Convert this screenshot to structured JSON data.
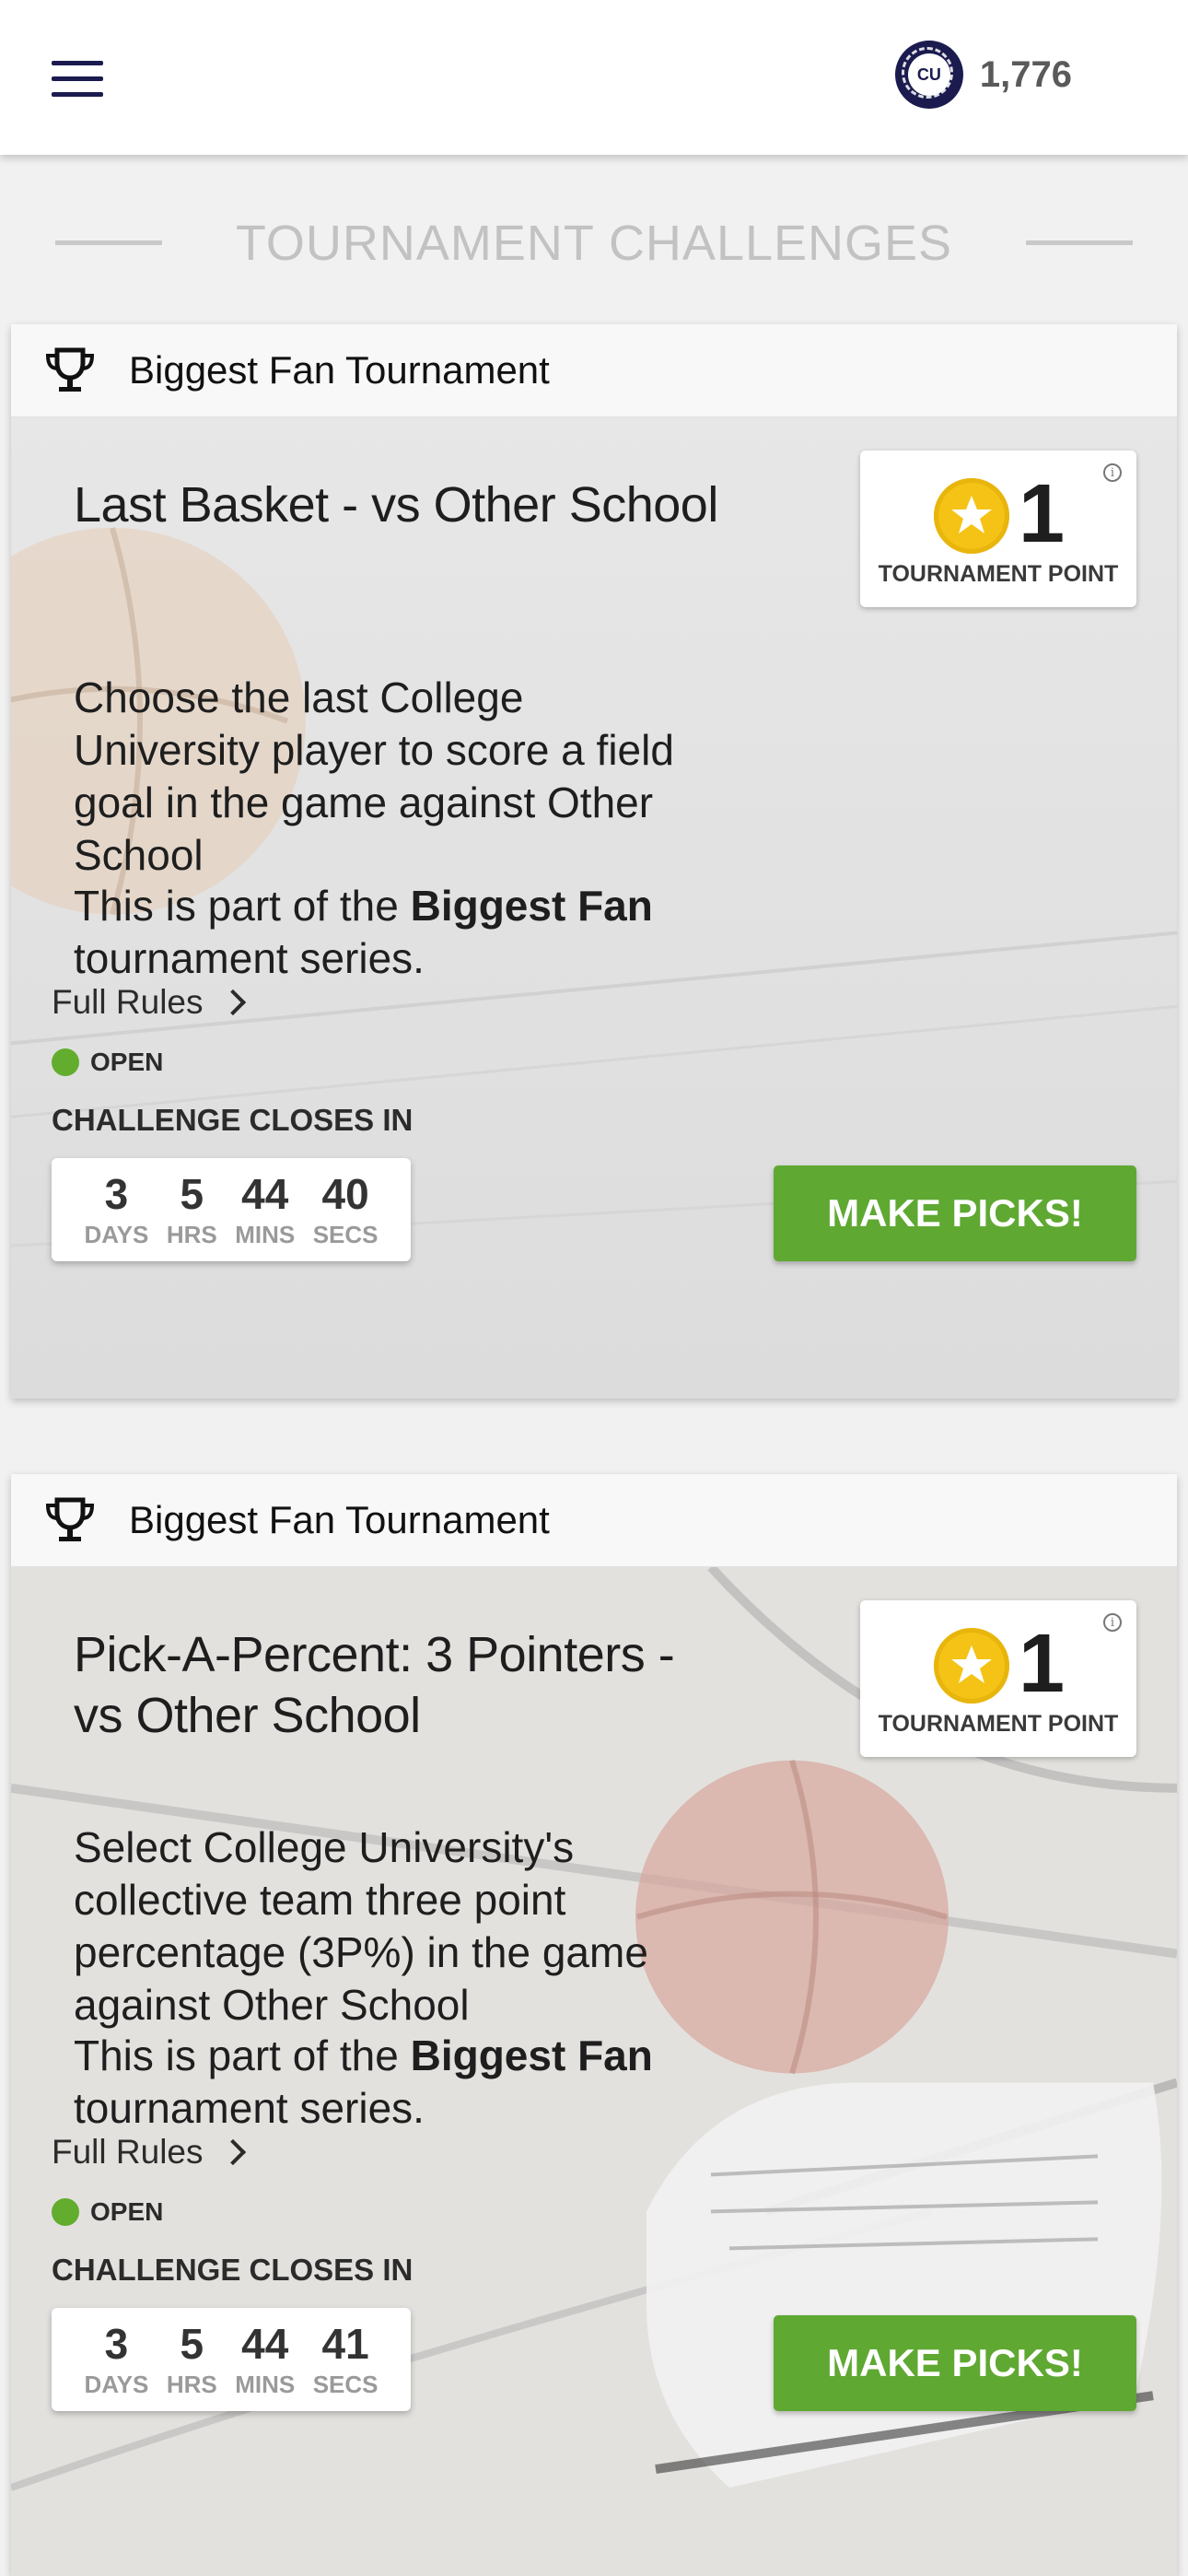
{
  "header": {
    "menu_icon": "hamburger-menu-icon",
    "logo_text": "CU",
    "points": "1,776"
  },
  "section": {
    "title": "TOURNAMENT CHALLENGES"
  },
  "colors": {
    "accent_green": "#5fa832",
    "brand_navy": "#1b1b4f",
    "star_gold": "#f4c316",
    "open_green": "#62ad2e"
  },
  "cards": [
    {
      "tournament": "Biggest Fan Tournament",
      "title": "Last Basket - vs Other School",
      "description": "Choose the last College University player to score a field goal in the game against Other School",
      "series_prefix": "This is part of the ",
      "series_name": "Biggest Fan",
      "series_suffix": " tournament series.",
      "points_value": "1",
      "points_label": "TOURNAMENT POINT",
      "rules_label": "Full Rules",
      "status": "OPEN",
      "closes_label": "CHALLENGE CLOSES IN",
      "countdown": [
        {
          "value": "3",
          "unit": "DAYS"
        },
        {
          "value": "5",
          "unit": "HRS"
        },
        {
          "value": "44",
          "unit": "MINS"
        },
        {
          "value": "40",
          "unit": "SECS"
        }
      ],
      "button_label": "MAKE PICKS!"
    },
    {
      "tournament": "Biggest Fan Tournament",
      "title": "Pick-A-Percent: 3 Pointers - vs Other School",
      "description": "Select College University's collective team three point percentage (3P%) in the game against Other School",
      "series_prefix": "This is part of the ",
      "series_name": "Biggest Fan",
      "series_suffix": " tournament series.",
      "points_value": "1",
      "points_label": "TOURNAMENT POINT",
      "rules_label": "Full Rules",
      "status": "OPEN",
      "closes_label": "CHALLENGE CLOSES IN",
      "countdown": [
        {
          "value": "3",
          "unit": "DAYS"
        },
        {
          "value": "5",
          "unit": "HRS"
        },
        {
          "value": "44",
          "unit": "MINS"
        },
        {
          "value": "41",
          "unit": "SECS"
        }
      ],
      "button_label": "MAKE PICKS!"
    }
  ]
}
